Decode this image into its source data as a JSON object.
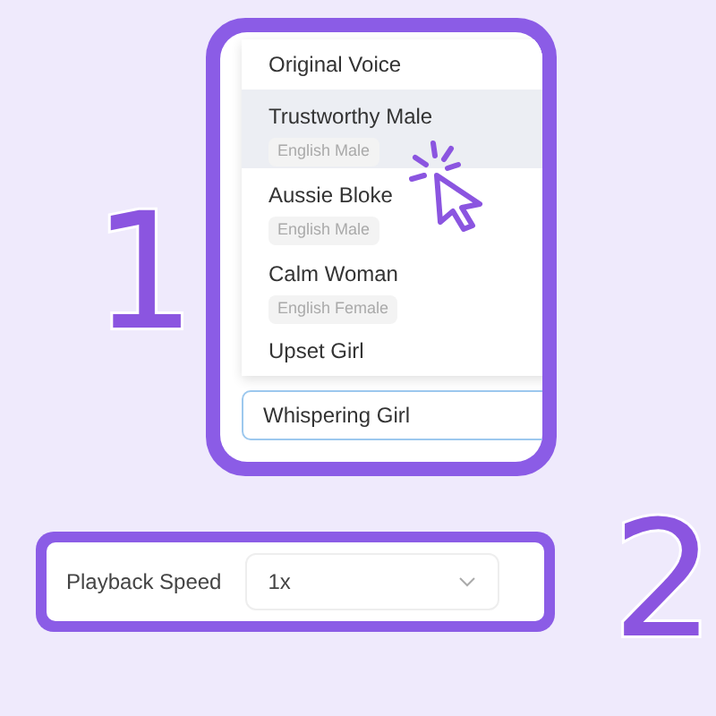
{
  "step_numbers": [
    "1",
    "2"
  ],
  "voice_dropdown": {
    "options": [
      {
        "name": "Original Voice",
        "selected": false
      },
      {
        "name": "Trustworthy Male",
        "tag": "English Male",
        "selected": true
      },
      {
        "name": "Aussie Bloke",
        "tag": "English Male",
        "selected": false
      },
      {
        "name": "Calm Woman",
        "tag": "English Female",
        "selected": false
      },
      {
        "name": "Upset Girl",
        "selected": false
      }
    ],
    "value": "Whispering Girl"
  },
  "playback_speed": {
    "label": "Playback Speed",
    "value": "1x"
  }
}
